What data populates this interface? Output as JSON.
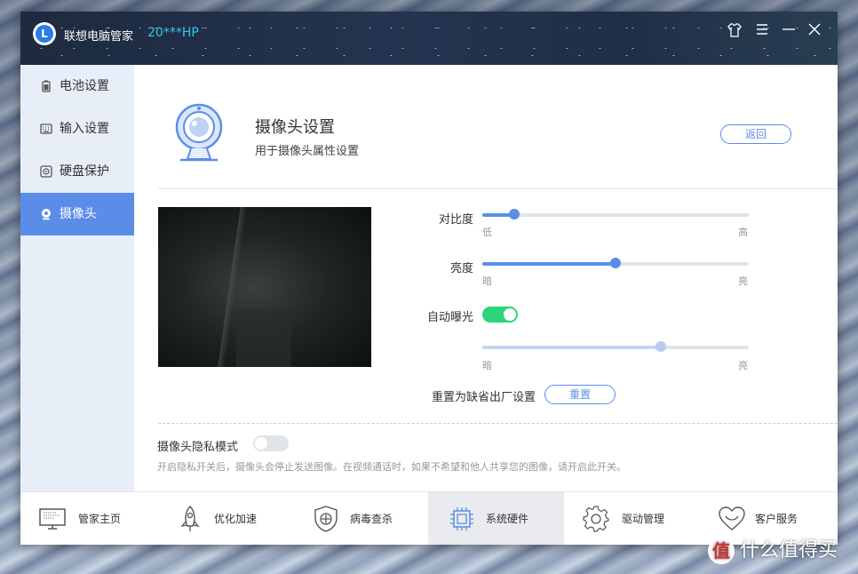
{
  "titlebar": {
    "logo_letter": "L",
    "app_title": "联想电脑管家",
    "device_name": "20***HP",
    "controls": [
      "skin-icon",
      "menu-icon",
      "minimize-icon",
      "close-icon"
    ]
  },
  "sidebar": {
    "items": [
      {
        "label": "电池设置",
        "icon": "battery-icon",
        "active": false
      },
      {
        "label": "输入设置",
        "icon": "keyboard-icon",
        "active": false
      },
      {
        "label": "硬盘保护",
        "icon": "disk-protect-icon",
        "active": false
      },
      {
        "label": "摄像头",
        "icon": "camera-icon",
        "active": true
      }
    ]
  },
  "header": {
    "title": "摄像头设置",
    "subtitle": "用于摄像头属性设置",
    "back_label": "返回"
  },
  "settings": {
    "contrast": {
      "label": "对比度",
      "min_label": "低",
      "max_label": "高",
      "value": 0.12
    },
    "brightness": {
      "label": "亮度",
      "min_label": "暗",
      "max_label": "亮",
      "value": 0.5
    },
    "auto_exposure": {
      "label": "自动曝光",
      "on": true,
      "min_label": "暗",
      "max_label": "亮",
      "value": 0.67,
      "disabled": true
    },
    "reset": {
      "label": "重置为缺省出厂设置",
      "button_label": "重置"
    }
  },
  "privacy": {
    "label": "摄像头隐私模式",
    "on": false,
    "description": "开启隐私开关后，摄像头会停止发送图像。在视频通话时，如果不希望和他人共享您的图像，请开启此开关。"
  },
  "bottom_nav": {
    "items": [
      {
        "label": "管家主页",
        "icon": "monitor-icon",
        "active": false
      },
      {
        "label": "优化加速",
        "icon": "rocket-icon",
        "active": false
      },
      {
        "label": "病毒查杀",
        "icon": "shield-icon",
        "active": false
      },
      {
        "label": "系统硬件",
        "icon": "chip-icon",
        "active": true
      },
      {
        "label": "驱动管理",
        "icon": "gear-icon",
        "active": false
      },
      {
        "label": "客户服务",
        "icon": "heart-icon",
        "active": false
      }
    ]
  },
  "watermark": {
    "glyph": "值",
    "text": "什么值得买"
  },
  "colors": {
    "accent": "#5b8de8",
    "toggle_on": "#2ed47a",
    "sidebar_bg": "#e8eef8",
    "title_cyan": "#35c6f0"
  }
}
